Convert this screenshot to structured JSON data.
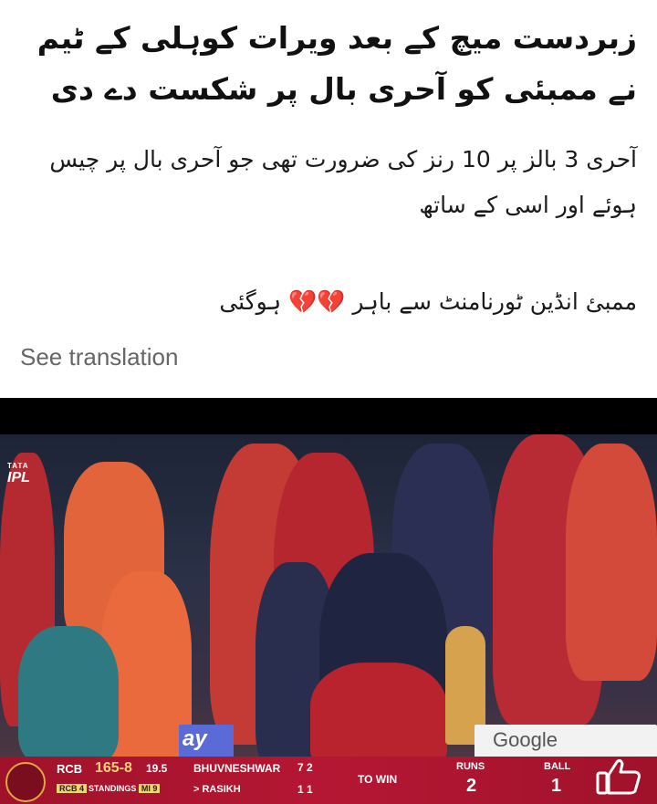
{
  "post": {
    "headline": "زبردست میچ کے بعد ویرات کوہلی کے ٹیم نے ممبئی کو آحری بال پر شکست دے دی",
    "body_line1": "آحری 3 بالز پر 10 رنز کی ضرورت تھی جو آحری بال پر چیس ہوئے اور اسی کے ساتھ",
    "body_line2": "ممبئ انڈین ٹورنامنٹ سے باہر",
    "body_line2_end": "ہوگئی",
    "hearts": "💔💔",
    "see_translation": "See translation"
  },
  "video": {
    "logo_tata": "TATA",
    "logo_ipl": "IPL",
    "ad_google": "Google",
    "ad_pay": "ay",
    "scoreboard": {
      "team": "RCB",
      "score": "165-8",
      "overs": "19.5",
      "standings_team": "RCB 4",
      "standings_label": "STANDINGS",
      "standings_opp": "MI 9",
      "batter1": "BHUVNESHWAR",
      "batter1_stat": "7  2",
      "batter2": "> RASIKH",
      "batter2_stat": "1  1",
      "to_win": "TO WIN",
      "runs_label": "RUNS",
      "runs_value": "2",
      "ball_label": "BALL",
      "ball_value": "1"
    }
  },
  "colors": {
    "scorebar": "#b51733",
    "score_accent": "#ffd27a",
    "heart": "#e0245e"
  },
  "icons": {
    "like": "thumbs-up-icon"
  }
}
